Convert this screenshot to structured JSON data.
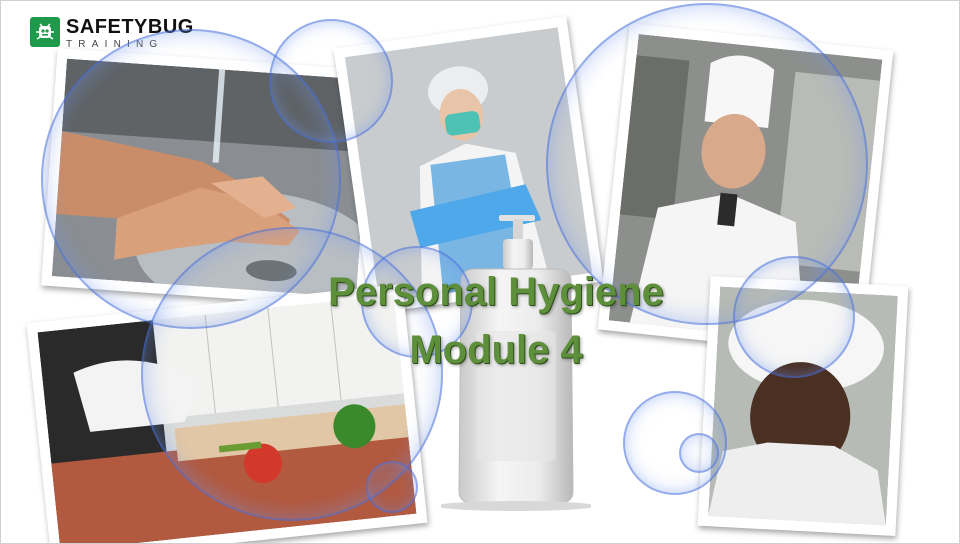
{
  "logo": {
    "name": "SAFETYBUG",
    "tagline": "TRAINING"
  },
  "title": {
    "line1": "Personal Hygiene",
    "line2": "Module 4"
  },
  "photos": [
    {
      "subject": "handwashing"
    },
    {
      "subject": "ppe-apron-hairnet"
    },
    {
      "subject": "chef"
    },
    {
      "subject": "gloved-food-prep"
    },
    {
      "subject": "worker-hairnet"
    }
  ],
  "colors": {
    "title_text": "#5e8f3a",
    "logo_green": "#1f9a4a",
    "bubble_edge": "#466edc"
  }
}
